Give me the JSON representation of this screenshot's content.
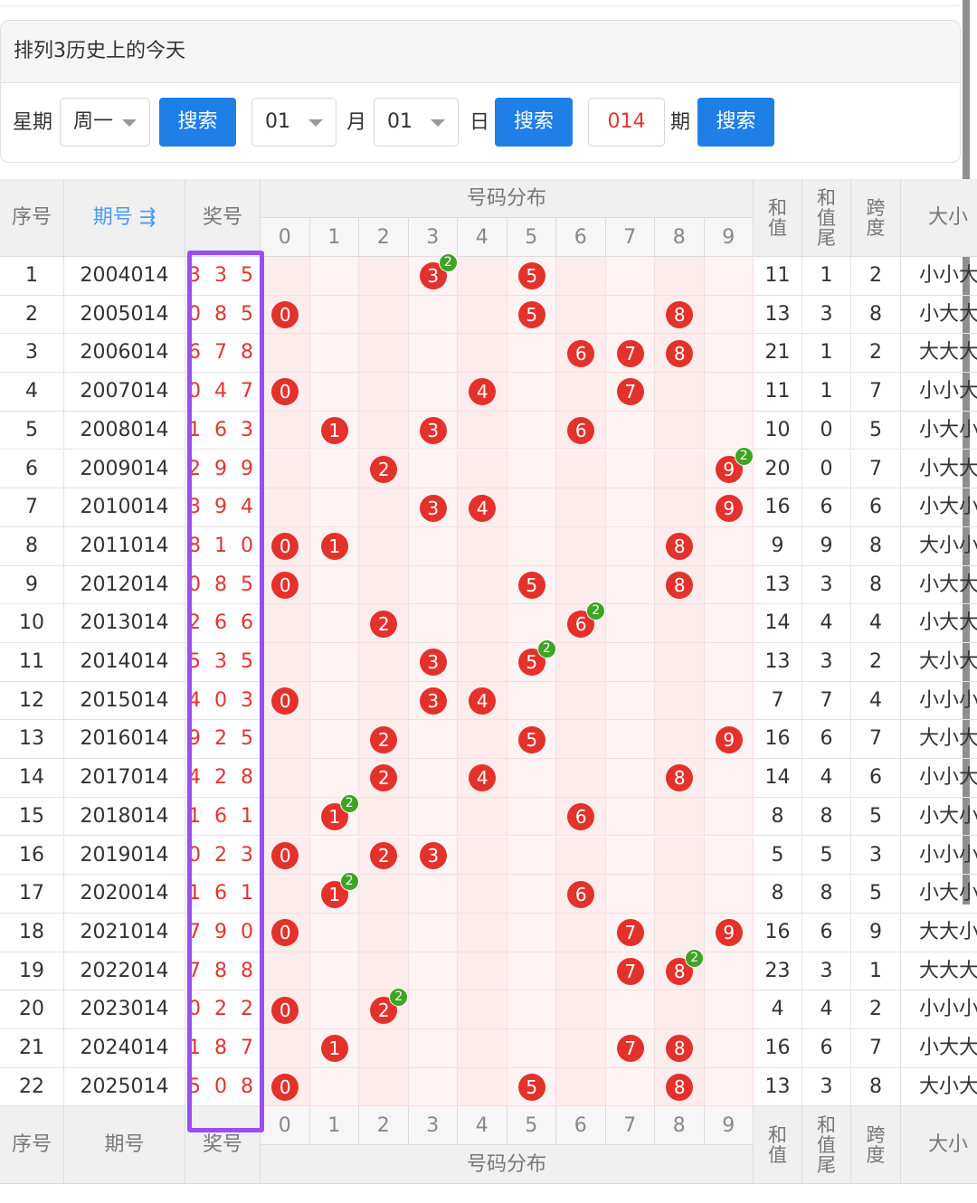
{
  "panel": {
    "title": "排列3历史上的今天",
    "weekday_label": "星期",
    "weekday_value": "周一",
    "search_label": "搜索",
    "month_value": "01",
    "month_label": "月",
    "day_value": "01",
    "day_label": "日",
    "issue_value": "014",
    "issue_label": "期"
  },
  "table": {
    "headers": {
      "seq": "序号",
      "issue": "期号",
      "sort_icon": "⇶",
      "prize": "奖号",
      "dist": "号码分布",
      "sum": "和值",
      "sum_tail": "和值尾",
      "span": "跨度",
      "size": "大小"
    },
    "digits": [
      "0",
      "1",
      "2",
      "3",
      "4",
      "5",
      "6",
      "7",
      "8",
      "9"
    ],
    "rows": [
      {
        "seq": "1",
        "issue": "2004014",
        "prize": "3 3 5",
        "sum": "11",
        "tail": "1",
        "span": "2",
        "size": "小小大",
        "nums": [
          3,
          3,
          5
        ]
      },
      {
        "seq": "2",
        "issue": "2005014",
        "prize": "0 8 5",
        "sum": "13",
        "tail": "3",
        "span": "8",
        "size": "小大大",
        "nums": [
          0,
          8,
          5
        ]
      },
      {
        "seq": "3",
        "issue": "2006014",
        "prize": "6 7 8",
        "sum": "21",
        "tail": "1",
        "span": "2",
        "size": "大大大",
        "nums": [
          6,
          7,
          8
        ]
      },
      {
        "seq": "4",
        "issue": "2007014",
        "prize": "0 4 7",
        "sum": "11",
        "tail": "1",
        "span": "7",
        "size": "小小大",
        "nums": [
          0,
          4,
          7
        ]
      },
      {
        "seq": "5",
        "issue": "2008014",
        "prize": "1 6 3",
        "sum": "10",
        "tail": "0",
        "span": "5",
        "size": "小大小",
        "nums": [
          1,
          6,
          3
        ]
      },
      {
        "seq": "6",
        "issue": "2009014",
        "prize": "2 9 9",
        "sum": "20",
        "tail": "0",
        "span": "7",
        "size": "小大大",
        "nums": [
          2,
          9,
          9
        ]
      },
      {
        "seq": "7",
        "issue": "2010014",
        "prize": "3 9 4",
        "sum": "16",
        "tail": "6",
        "span": "6",
        "size": "小大小",
        "nums": [
          3,
          9,
          4
        ]
      },
      {
        "seq": "8",
        "issue": "2011014",
        "prize": "8 1 0",
        "sum": "9",
        "tail": "9",
        "span": "8",
        "size": "大小小",
        "nums": [
          8,
          1,
          0
        ]
      },
      {
        "seq": "9",
        "issue": "2012014",
        "prize": "0 8 5",
        "sum": "13",
        "tail": "3",
        "span": "8",
        "size": "小大大",
        "nums": [
          0,
          8,
          5
        ]
      },
      {
        "seq": "10",
        "issue": "2013014",
        "prize": "2 6 6",
        "sum": "14",
        "tail": "4",
        "span": "4",
        "size": "小大大",
        "nums": [
          2,
          6,
          6
        ]
      },
      {
        "seq": "11",
        "issue": "2014014",
        "prize": "5 3 5",
        "sum": "13",
        "tail": "3",
        "span": "2",
        "size": "大小大",
        "nums": [
          5,
          3,
          5
        ]
      },
      {
        "seq": "12",
        "issue": "2015014",
        "prize": "4 0 3",
        "sum": "7",
        "tail": "7",
        "span": "4",
        "size": "小小小",
        "nums": [
          4,
          0,
          3
        ]
      },
      {
        "seq": "13",
        "issue": "2016014",
        "prize": "9 2 5",
        "sum": "16",
        "tail": "6",
        "span": "7",
        "size": "大小大",
        "nums": [
          9,
          2,
          5
        ]
      },
      {
        "seq": "14",
        "issue": "2017014",
        "prize": "4 2 8",
        "sum": "14",
        "tail": "4",
        "span": "6",
        "size": "小小大",
        "nums": [
          4,
          2,
          8
        ]
      },
      {
        "seq": "15",
        "issue": "2018014",
        "prize": "1 6 1",
        "sum": "8",
        "tail": "8",
        "span": "5",
        "size": "小大小",
        "nums": [
          1,
          6,
          1
        ]
      },
      {
        "seq": "16",
        "issue": "2019014",
        "prize": "0 2 3",
        "sum": "5",
        "tail": "5",
        "span": "3",
        "size": "小小小",
        "nums": [
          0,
          2,
          3
        ]
      },
      {
        "seq": "17",
        "issue": "2020014",
        "prize": "1 6 1",
        "sum": "8",
        "tail": "8",
        "span": "5",
        "size": "小大小",
        "nums": [
          1,
          6,
          1
        ]
      },
      {
        "seq": "18",
        "issue": "2021014",
        "prize": "7 9 0",
        "sum": "16",
        "tail": "6",
        "span": "9",
        "size": "大大小",
        "nums": [
          7,
          9,
          0
        ]
      },
      {
        "seq": "19",
        "issue": "2022014",
        "prize": "7 8 8",
        "sum": "23",
        "tail": "3",
        "span": "1",
        "size": "大大大",
        "nums": [
          7,
          8,
          8
        ]
      },
      {
        "seq": "20",
        "issue": "2023014",
        "prize": "0 2 2",
        "sum": "4",
        "tail": "4",
        "span": "2",
        "size": "小小小",
        "nums": [
          0,
          2,
          2
        ]
      },
      {
        "seq": "21",
        "issue": "2024014",
        "prize": "1 8 7",
        "sum": "16",
        "tail": "6",
        "span": "7",
        "size": "小大大",
        "nums": [
          1,
          8,
          7
        ]
      },
      {
        "seq": "22",
        "issue": "2025014",
        "prize": "5 0 8",
        "sum": "13",
        "tail": "3",
        "span": "8",
        "size": "大小大",
        "nums": [
          5,
          0,
          8
        ]
      }
    ]
  }
}
